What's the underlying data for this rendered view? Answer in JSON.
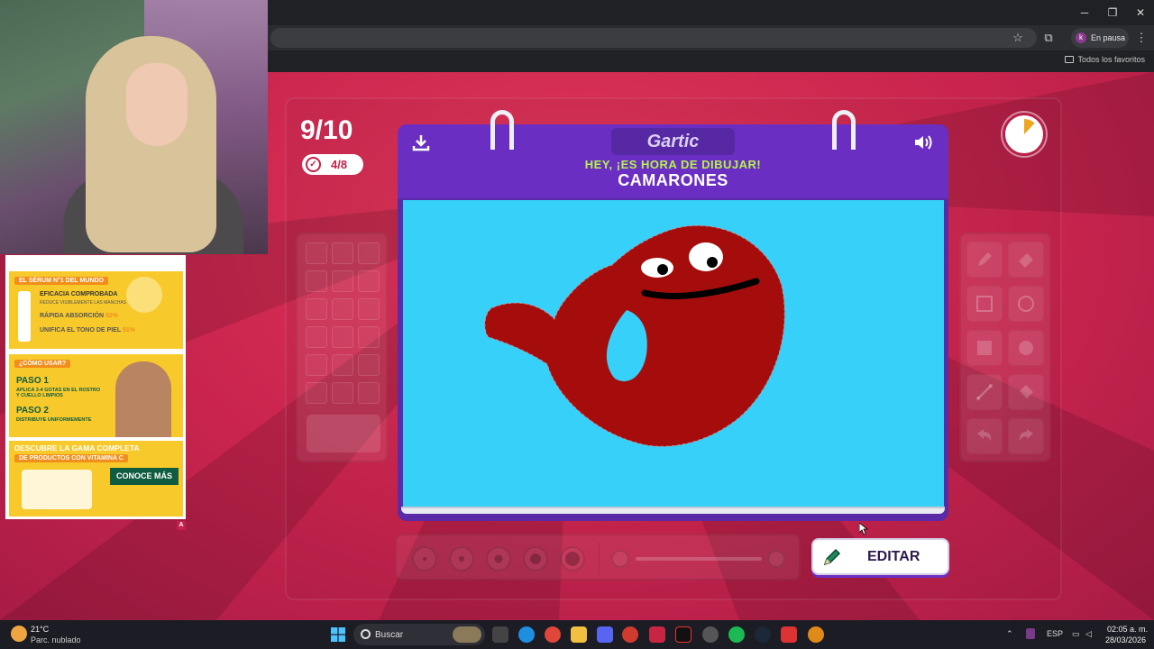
{
  "browser": {
    "profile_initial": "k",
    "profile_status": "En pausa",
    "bookmarks_all": "Todos los favoritos",
    "window_controls": [
      "minimize-icon",
      "maximize-icon",
      "close-icon"
    ]
  },
  "game": {
    "round": "9/10",
    "progress": "4/8",
    "logo": "Gartic",
    "prompt": "HEY, ¡ES HORA DE DIBUJAR!",
    "word": "CAMARONES",
    "edit_label": "EDITAR",
    "timer_fraction_elapsed": 0.12,
    "colors": {
      "background": "#c9244e",
      "notebook": "#6a2fc2",
      "canvas": "#37d0f8",
      "drawing_fill": "#a50d0d",
      "prompt_text": "#b4f34d"
    },
    "tools": [
      "pencil-icon",
      "eraser-icon",
      "rectangle-icon",
      "circle-icon",
      "filled-rectangle-icon",
      "filled-circle-icon",
      "line-icon",
      "fill-bucket-icon",
      "undo-icon",
      "redo-icon"
    ]
  },
  "ad": {
    "tag1": "EL SÉRUM N°1 DEL MUNDO",
    "line1": "EFICACIA COMPROBADA",
    "line1_sub": "REDUCE VISIBLEMENTE LAS MANCHAS",
    "line2": "RÁPIDA ABSORCIÓN",
    "line2_pct": "92%",
    "line3": "UNIFICA EL TONO DE PIEL",
    "line3_pct": "91%",
    "tag2": "¿CÓMO USAR?",
    "step1": "PASO 1",
    "step1_text": "APLICA 3-4 GOTAS EN EL ROSTRO Y CUELLO LIMPIOS",
    "step2": "PASO 2",
    "step2_text": "DISTRIBUYE UNIFORMEMENTE",
    "cta_headline": "DESCUBRE LA GAMA COMPLETA",
    "cta_tag": "DE PRODUCTOS CON VITAMINA C",
    "cta_button": "CONOCE MÁS",
    "marker": "A"
  },
  "taskbar": {
    "temperature": "21°C",
    "weather": "Parc. nublado",
    "search_placeholder": "Buscar",
    "language": "ESP",
    "time": "02:05 a. m.",
    "date": "28/03/2026"
  }
}
